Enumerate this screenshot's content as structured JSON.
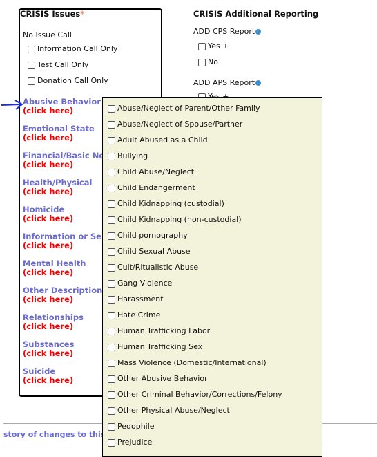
{
  "crisis_issues": {
    "title": "CRISIS Issues",
    "required_mark": "*",
    "no_issue_label": "No Issue Call",
    "no_issue_options": [
      "Information Call Only",
      "Test Call Only",
      "Donation Call Only"
    ],
    "categories": [
      {
        "name": "Abusive Behavior",
        "link": "(click here)"
      },
      {
        "name": "Emotional State",
        "link": "(click here)"
      },
      {
        "name": "Financial/Basic Needs",
        "link": "(click here)"
      },
      {
        "name": "Health/Physical",
        "link": "(click here)"
      },
      {
        "name": "Homicide",
        "link": "(click here)"
      },
      {
        "name": "Information or Services",
        "link": "(click here)"
      },
      {
        "name": "Mental Health",
        "link": "(click here)"
      },
      {
        "name": "Other Description",
        "link": "(click here)"
      },
      {
        "name": "Relationships",
        "link": "(click here)"
      },
      {
        "name": "Substances",
        "link": "(click here)"
      },
      {
        "name": "Suicide",
        "link": "(click here)"
      }
    ]
  },
  "additional_reporting": {
    "title": "CRISIS Additional Reporting",
    "cps_label": "ADD CPS Report",
    "cps_options": [
      "Yes +",
      "No"
    ],
    "aps_label": "ADD APS Report",
    "aps_options": [
      "Yes +"
    ]
  },
  "popup": {
    "items": [
      "Abuse/Neglect of Parent/Other Family",
      "Abuse/Neglect of Spouse/Partner",
      "Adult Abused as a Child",
      "Bullying",
      "Child Abuse/Neglect",
      "Child Endangerment",
      "Child Kidnapping (custodial)",
      "Child Kidnapping (non-custodial)",
      "Child pornography",
      "Child Sexual Abuse",
      "Cult/Ritualistic Abuse",
      "Gang Violence",
      "Harassment",
      "Hate Crime",
      "Human Trafficking Labor",
      "Human Trafficking Sex",
      "Mass Violence (Domestic/International)",
      "Other Abusive Behavior",
      "Other Criminal Behavior/Corrections/Felony",
      "Other Physical Abuse/Neglect",
      "Pedophile",
      "Prejudice"
    ]
  },
  "footer": {
    "history_link": "story of changes to this"
  }
}
